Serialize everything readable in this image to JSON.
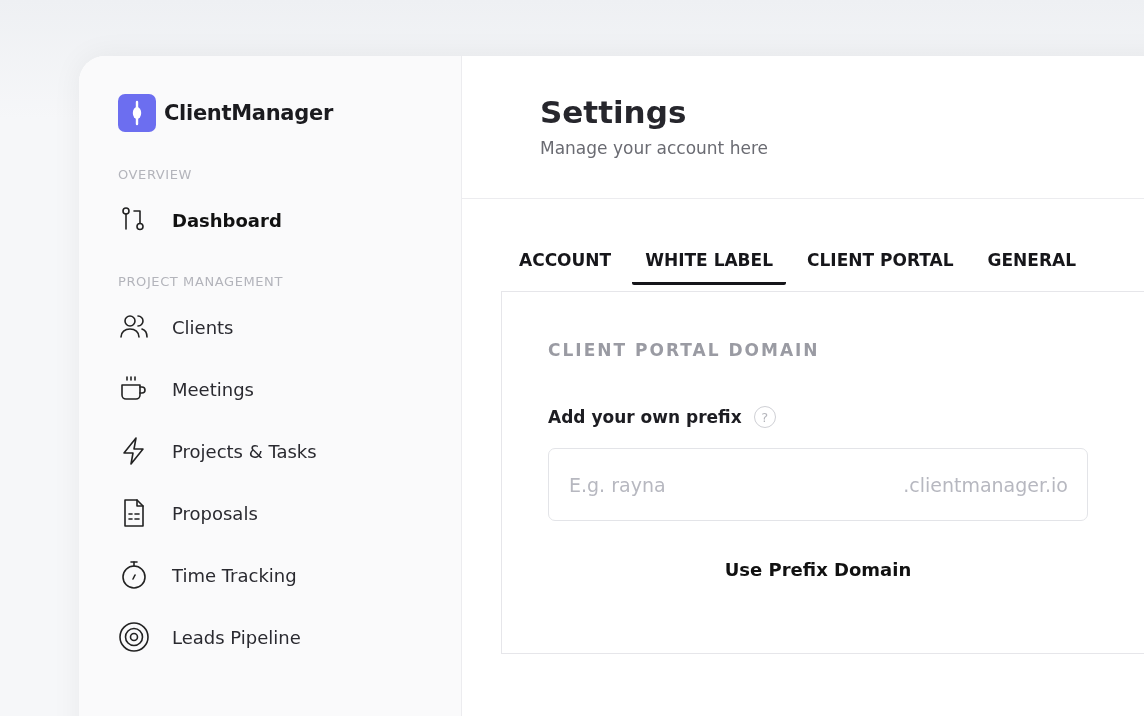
{
  "brand": {
    "name": "ClientManager"
  },
  "sidebar": {
    "sections": [
      {
        "heading": "OVERVIEW",
        "items": [
          {
            "kind": "dashboard",
            "label": "Dashboard",
            "selected": true
          }
        ]
      },
      {
        "heading": "PROJECT MANAGEMENT",
        "items": [
          {
            "kind": "clients",
            "label": "Clients",
            "selected": false
          },
          {
            "kind": "meetings",
            "label": "Meetings",
            "selected": false
          },
          {
            "kind": "projects",
            "label": "Projects & Tasks",
            "selected": false
          },
          {
            "kind": "proposals",
            "label": "Proposals",
            "selected": false
          },
          {
            "kind": "time",
            "label": "Time Tracking",
            "selected": false
          },
          {
            "kind": "leads",
            "label": "Leads Pipeline",
            "selected": false
          }
        ]
      }
    ]
  },
  "header": {
    "title": "Settings",
    "subtitle": "Manage your account here"
  },
  "tabs": [
    {
      "label": "ACCOUNT",
      "selected": false
    },
    {
      "label": "WHITE LABEL",
      "selected": true
    },
    {
      "label": "CLIENT PORTAL",
      "selected": false
    },
    {
      "label": "GENERAL",
      "selected": false
    }
  ],
  "panel": {
    "heading": "CLIENT PORTAL DOMAIN",
    "field_label": "Add your own prefix",
    "help": "?",
    "placeholder": "E.g. rayna",
    "suffix": ".clientmanager.io",
    "button": "Use Prefix Domain"
  }
}
